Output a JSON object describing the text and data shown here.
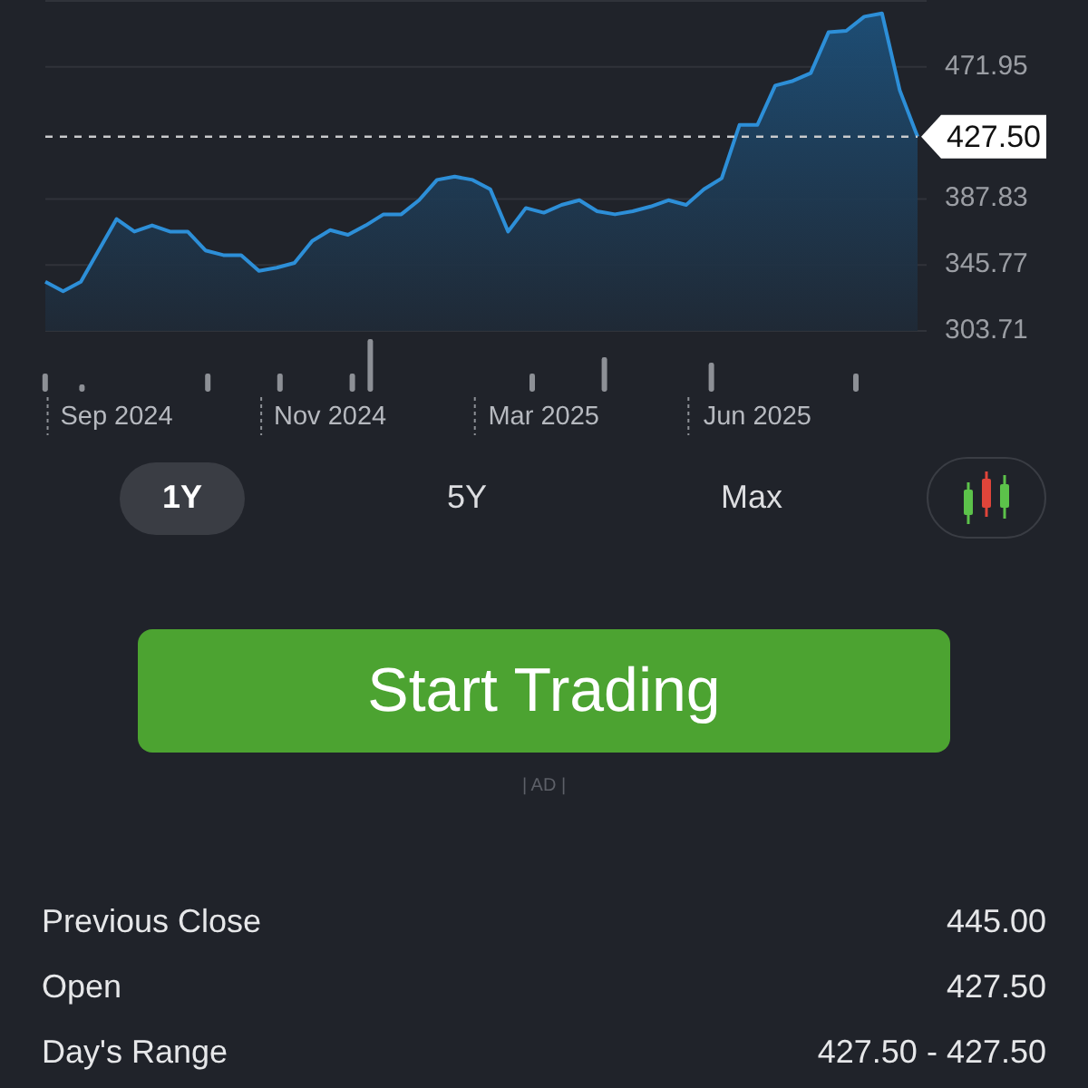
{
  "chart": {
    "chart_data": {
      "type": "area",
      "grid": true,
      "categories": [
        null,
        null,
        null,
        null,
        "Sep 2024",
        null,
        null,
        null,
        null,
        null,
        null,
        null,
        null,
        null,
        null,
        null,
        "Nov 2024",
        null,
        null,
        null,
        null,
        null,
        null,
        null,
        null,
        null,
        null,
        null,
        "Mar 2025",
        null,
        null,
        null,
        null,
        null,
        null,
        null,
        null,
        null,
        null,
        null,
        "Jun 2025",
        null,
        null,
        null,
        null,
        null,
        null,
        null,
        null,
        null
      ],
      "ylim": [
        303.71,
        514.01
      ],
      "yticks": [
        303.71,
        345.77,
        387.83,
        471.95
      ],
      "values": [
        335,
        329,
        335,
        355,
        375,
        367,
        371,
        367,
        367,
        355,
        352,
        352,
        342,
        344,
        347,
        361,
        368,
        365,
        371,
        378,
        378,
        387,
        400,
        402,
        400,
        394,
        367,
        382,
        379,
        384,
        387,
        380,
        378,
        380,
        383,
        387,
        384,
        394,
        401,
        435,
        435,
        460,
        463,
        468,
        494,
        495,
        504,
        506,
        457,
        427.5
      ],
      "ref_lines": [
        {
          "axis": "y",
          "value": 427.5,
          "label": "427.50"
        }
      ]
    }
  },
  "timeframes": [
    {
      "label": "1Y",
      "selected": true
    },
    {
      "label": "5Y",
      "selected": false
    },
    {
      "label": "Max",
      "selected": false
    }
  ],
  "cta": {
    "label": "Start Trading",
    "ad_label": "| AD |"
  },
  "stats": [
    {
      "label": "Previous Close",
      "value": "445.00"
    },
    {
      "label": "Open",
      "value": "427.50"
    },
    {
      "label": "Day's Range",
      "value": "427.50 - 427.50"
    }
  ]
}
